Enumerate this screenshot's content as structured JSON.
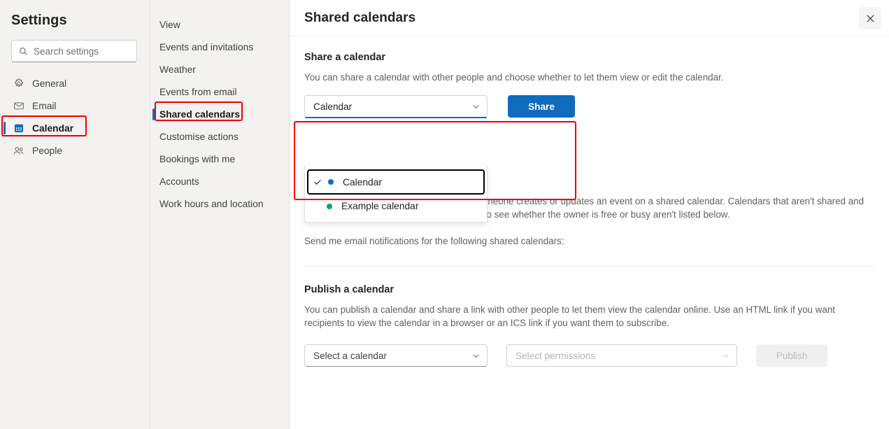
{
  "sidebar": {
    "title": "Settings",
    "search": {
      "placeholder": "Search settings",
      "icon": "search-icon"
    },
    "items": [
      {
        "label": "General",
        "icon": "gear-icon",
        "selected": false
      },
      {
        "label": "Email",
        "icon": "envelope-icon",
        "selected": false
      },
      {
        "label": "Calendar",
        "icon": "calendar-icon",
        "selected": true
      },
      {
        "label": "People",
        "icon": "people-icon",
        "selected": false
      }
    ]
  },
  "midnav": {
    "items": [
      {
        "label": "View",
        "selected": false
      },
      {
        "label": "Events and invitations",
        "selected": false
      },
      {
        "label": "Weather",
        "selected": false
      },
      {
        "label": "Events from email",
        "selected": false
      },
      {
        "label": "Shared calendars",
        "selected": true
      },
      {
        "label": "Customise actions",
        "selected": false
      },
      {
        "label": "Bookings with me",
        "selected": false
      },
      {
        "label": "Accounts",
        "selected": false
      },
      {
        "label": "Work hours and location",
        "selected": false
      }
    ]
  },
  "main": {
    "title": "Shared calendars",
    "close_icon": "close-icon",
    "share_section": {
      "heading": "Share a calendar",
      "description": "You can share a calendar with other people and choose whether to let them view or edit the calendar.",
      "calendar_select": {
        "value": "Calendar",
        "chevron_icon": "chevron-down-icon",
        "expanded": true,
        "options": [
          {
            "label": "Calendar",
            "dot_color": "#0f6cbd",
            "checked": true,
            "highlighted": true
          },
          {
            "label": "Example calendar",
            "dot_color": "#0fa36b",
            "checked": false,
            "highlighted": false
          }
        ]
      },
      "share_button": "Share"
    },
    "notifications_section": {
      "description": "You can receive email notifications when someone creates or updates an event on a shared calendar. Calendars that aren't shared and calendars where you only have permission to see whether the owner is free or busy aren't listed below.",
      "label": "Send me email notifications for the following shared calendars:"
    },
    "publish_section": {
      "heading": "Publish a calendar",
      "description": "You can publish a calendar and share a link with other people to let them view the calendar online. Use an HTML link if you want recipients to view the calendar in a browser or an ICS link if you want them to subscribe.",
      "calendar_select": {
        "placeholder": "Select a calendar",
        "chevron_icon": "chevron-down-icon"
      },
      "permissions_select": {
        "placeholder": "Select permissions",
        "chevron_icon": "chevron-down-icon"
      },
      "publish_button": "Publish"
    }
  },
  "colors": {
    "accent": "#0f6cbd",
    "highlight_box": "#ee0000",
    "sidebar_bg": "#f3f2f1",
    "panel_bg": "#ffffff",
    "green_dot": "#0fa36b"
  }
}
